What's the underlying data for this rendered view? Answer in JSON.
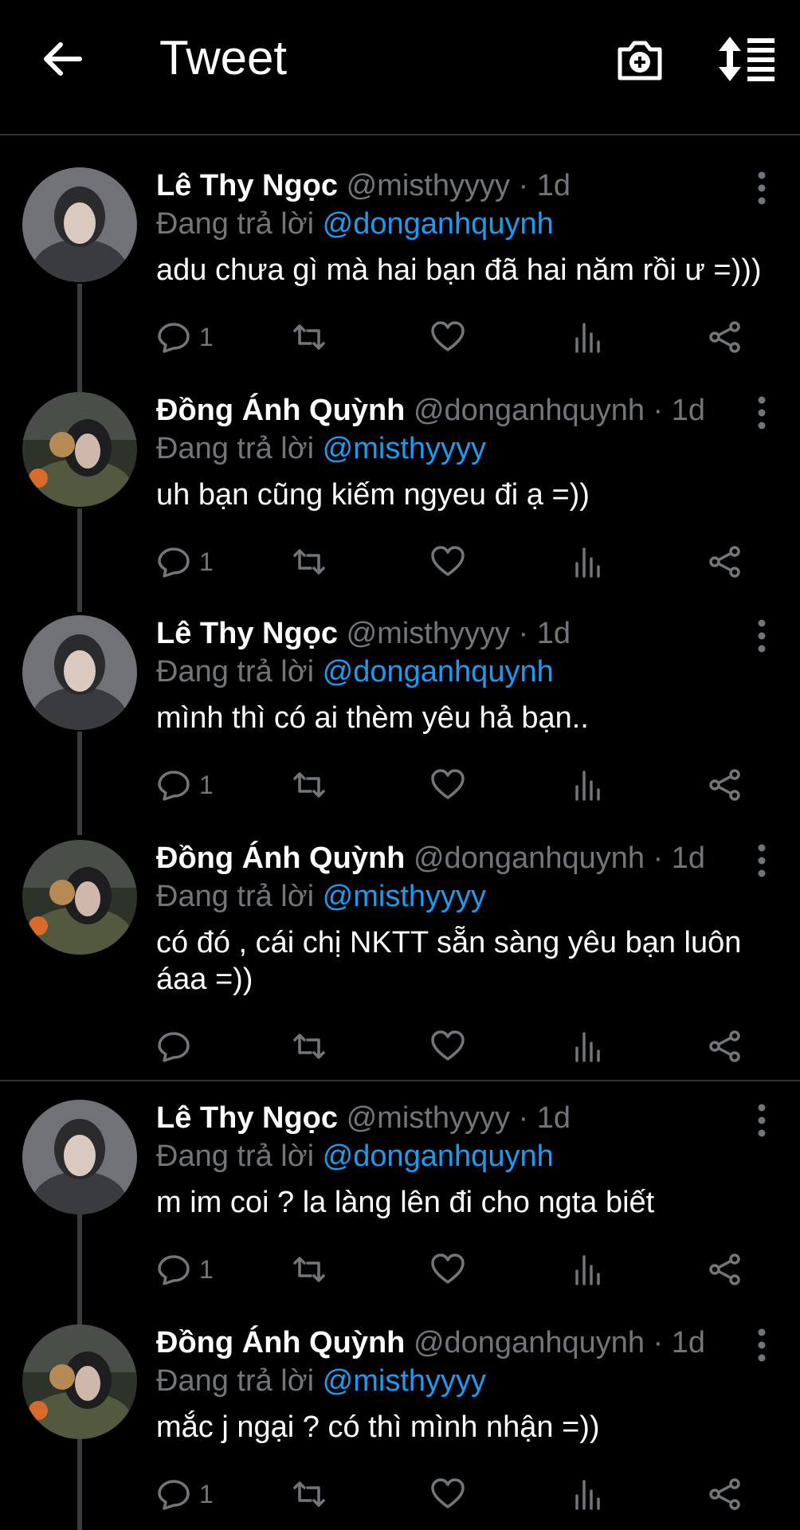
{
  "header": {
    "title": "Tweet"
  },
  "tweets": [
    {
      "name": "Lê Thy Ngọc",
      "handle": "@misthyyyy · 1d",
      "reply_prefix": "Đang trả lời ",
      "reply_to": "@donganhquynh",
      "text": "adu chưa gì mà hai bạn đã hai năm rồi ư =)))",
      "replies": "1"
    },
    {
      "name": "Đồng Ánh Quỳnh",
      "handle": "@donganhquynh · 1d",
      "reply_prefix": "Đang trả lời ",
      "reply_to": "@misthyyyy",
      "text": "uh bạn cũng kiếm ngyeu đi ạ =))",
      "replies": "1"
    },
    {
      "name": "Lê Thy Ngọc",
      "handle": "@misthyyyy · 1d",
      "reply_prefix": "Đang trả lời ",
      "reply_to": "@donganhquynh",
      "text": "mình thì có ai thèm yêu hả bạn..",
      "replies": "1"
    },
    {
      "name": "Đồng Ánh Quỳnh",
      "handle": "@donganhquynh · 1d",
      "reply_prefix": "Đang trả lời ",
      "reply_to": "@misthyyyy",
      "text": "có đó , cái chị NKTT sẵn sàng yêu bạn luôn áaa =))",
      "replies": ""
    },
    {
      "name": "Lê Thy Ngọc",
      "handle": "@misthyyyy · 1d",
      "reply_prefix": "Đang trả lời ",
      "reply_to": "@donganhquynh",
      "text": "m im coi ? la làng lên đi cho ngta biết",
      "replies": "1"
    },
    {
      "name": "Đồng Ánh Quỳnh",
      "handle": "@donganhquynh · 1d",
      "reply_prefix": "Đang trả lời ",
      "reply_to": "@misthyyyy",
      "text": "mắc j ngại ? có thì mình nhận =))",
      "replies": "1"
    }
  ],
  "icons": [
    "back-arrow-icon",
    "camera-plus-icon",
    "sort-icon",
    "more-vertical-icon",
    "reply-icon",
    "retweet-icon",
    "like-icon",
    "analytics-icon",
    "share-icon"
  ],
  "colors": {
    "background": "#000000",
    "link": "#1d9bf0",
    "muted": "#71767b"
  }
}
